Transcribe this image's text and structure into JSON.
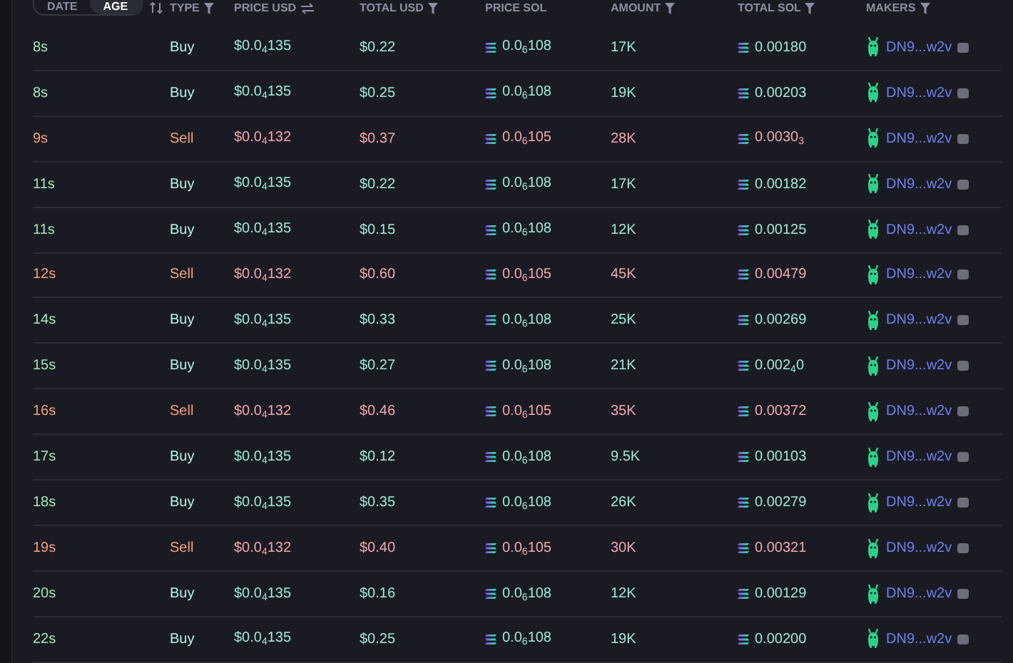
{
  "header": {
    "modes": [
      {
        "label": "DATE",
        "selected": false
      },
      {
        "label": "AGE",
        "selected": true
      }
    ],
    "columns": [
      "TYPE",
      "PRICE USD",
      "TOTAL USD",
      "PRICE SOL",
      "AMOUNT",
      "TOTAL SOL",
      "MAKERS"
    ]
  },
  "rows": [
    {
      "kind": "buy",
      "age": "8s",
      "type": "Buy",
      "price_usd": "$0.0$_{4}$135",
      "total_usd": "$0.22",
      "price_sol": "0.0$_{6}$108",
      "amount": "17K",
      "total_sol": "0.00180",
      "maker": "DN9...w2v"
    },
    {
      "kind": "buy",
      "age": "8s",
      "type": "Buy",
      "price_usd": "$0.0$_{4}$135",
      "total_usd": "$0.25",
      "price_sol": "0.0$_{6}$108",
      "amount": "19K",
      "total_sol": "0.00203",
      "maker": "DN9...w2v"
    },
    {
      "kind": "sell",
      "age": "9s",
      "type": "Sell",
      "price_usd": "$0.0$_{4}$132",
      "total_usd": "$0.37",
      "price_sol": "0.0$_{6}$105",
      "amount": "28K",
      "total_sol": "0.0030$_{3}$",
      "maker": "DN9...w2v"
    },
    {
      "kind": "buy",
      "age": "11s",
      "type": "Buy",
      "price_usd": "$0.0$_{4}$135",
      "total_usd": "$0.22",
      "price_sol": "0.0$_{6}$108",
      "amount": "17K",
      "total_sol": "0.00182",
      "maker": "DN9...w2v"
    },
    {
      "kind": "buy",
      "age": "11s",
      "type": "Buy",
      "price_usd": "$0.0$_{4}$135",
      "total_usd": "$0.15",
      "price_sol": "0.0$_{6}$108",
      "amount": "12K",
      "total_sol": "0.00125",
      "maker": "DN9...w2v"
    },
    {
      "kind": "sell",
      "age": "12s",
      "type": "Sell",
      "price_usd": "$0.0$_{4}$132",
      "total_usd": "$0.60",
      "price_sol": "0.0$_{6}$105",
      "amount": "45K",
      "total_sol": "0.00479",
      "maker": "DN9...w2v"
    },
    {
      "kind": "buy",
      "age": "14s",
      "type": "Buy",
      "price_usd": "$0.0$_{4}$135",
      "total_usd": "$0.33",
      "price_sol": "0.0$_{6}$108",
      "amount": "25K",
      "total_sol": "0.00269",
      "maker": "DN9...w2v"
    },
    {
      "kind": "buy",
      "age": "15s",
      "type": "Buy",
      "price_usd": "$0.0$_{4}$135",
      "total_usd": "$0.27",
      "price_sol": "0.0$_{6}$108",
      "amount": "21K",
      "total_sol": "0.002$_{4}$0",
      "maker": "DN9...w2v"
    },
    {
      "kind": "sell",
      "age": "16s",
      "type": "Sell",
      "price_usd": "$0.0$_{4}$132",
      "total_usd": "$0.46",
      "price_sol": "0.0$_{6}$105",
      "amount": "35K",
      "total_sol": "0.00372",
      "maker": "DN9...w2v"
    },
    {
      "kind": "buy",
      "age": "17s",
      "type": "Buy",
      "price_usd": "$0.0$_{4}$135",
      "total_usd": "$0.12",
      "price_sol": "0.0$_{6}$108",
      "amount": "9.5K",
      "total_sol": "0.00103",
      "maker": "DN9...w2v"
    },
    {
      "kind": "buy",
      "age": "18s",
      "type": "Buy",
      "price_usd": "$0.0$_{4}$135",
      "total_usd": "$0.35",
      "price_sol": "0.0$_{6}$108",
      "amount": "26K",
      "total_sol": "0.00279",
      "maker": "DN9...w2v"
    },
    {
      "kind": "sell",
      "age": "19s",
      "type": "Sell",
      "price_usd": "$0.0$_{4}$132",
      "total_usd": "$0.40",
      "price_sol": "0.0$_{6}$105",
      "amount": "30K",
      "total_sol": "0.00321",
      "maker": "DN9...w2v"
    },
    {
      "kind": "buy",
      "age": "20s",
      "type": "Buy",
      "price_usd": "$0.0$_{4}$135",
      "total_usd": "$0.16",
      "price_sol": "0.0$_{6}$108",
      "amount": "12K",
      "total_sol": "0.00129",
      "maker": "DN9...w2v"
    },
    {
      "kind": "buy",
      "age": "22s",
      "type": "Buy",
      "price_usd": "$0.0$_{4}$135",
      "total_usd": "$0.25",
      "price_sol": "0.0$_{6}$108",
      "amount": "19K",
      "total_sol": "0.00200",
      "maker": "DN9...w2v"
    }
  ]
}
